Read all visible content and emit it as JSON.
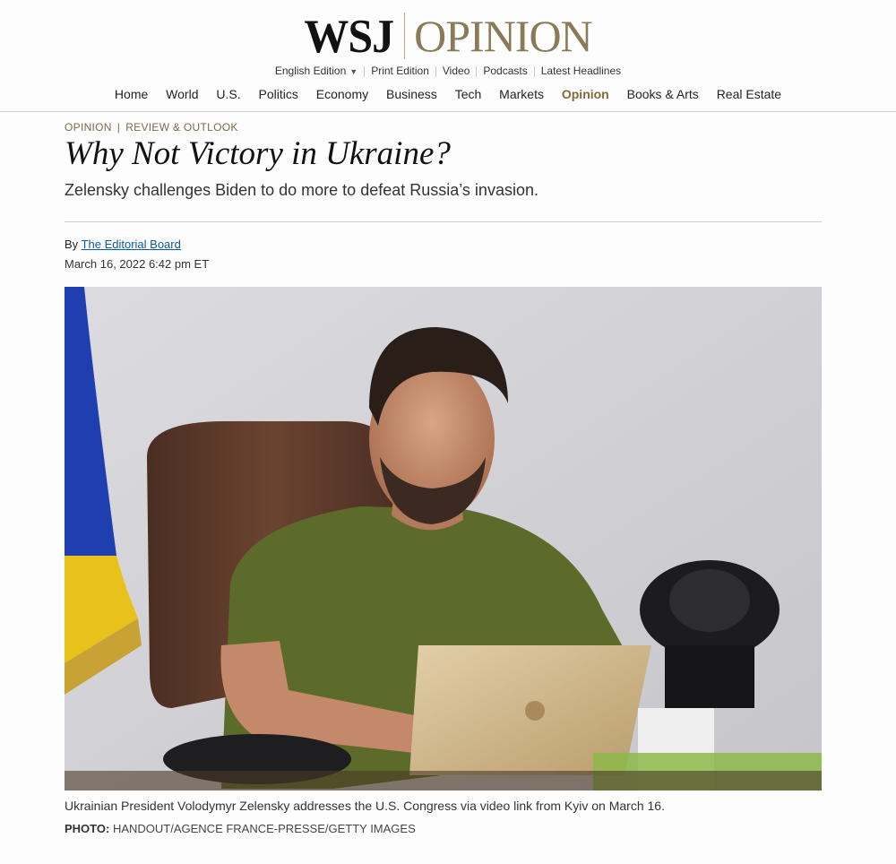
{
  "masthead": {
    "logo_wsj": "WSJ",
    "logo_section": "OPINION",
    "subnav": [
      "English Edition",
      "Print Edition",
      "Video",
      "Podcasts",
      "Latest Headlines"
    ]
  },
  "mainnav": [
    "Home",
    "World",
    "U.S.",
    "Politics",
    "Economy",
    "Business",
    "Tech",
    "Markets",
    "Opinion",
    "Books & Arts",
    "Real Estate"
  ],
  "mainnav_active": "Opinion",
  "article": {
    "flashline_section": "OPINION",
    "flashline_subsection": "REVIEW & OUTLOOK",
    "headline": "Why Not Victory in Ukraine?",
    "dek": "Zelensky challenges Biden to do more to defeat Russia’s invasion.",
    "byline_prefix": "By",
    "author": "The Editorial Board",
    "timestamp": "March 16, 2022 6:42 pm ET"
  },
  "photo": {
    "caption": "Ukrainian President Volodymyr Zelensky addresses the U.S. Congress via video link from Kyiv on March 16.",
    "credit_label": "PHOTO:",
    "credit": "HANDOUT/AGENCE FRANCE-PRESSE/GETTY IMAGES"
  },
  "colors": {
    "opinion_gold": "#8a7a55",
    "link_blue": "#0a5a9c"
  }
}
